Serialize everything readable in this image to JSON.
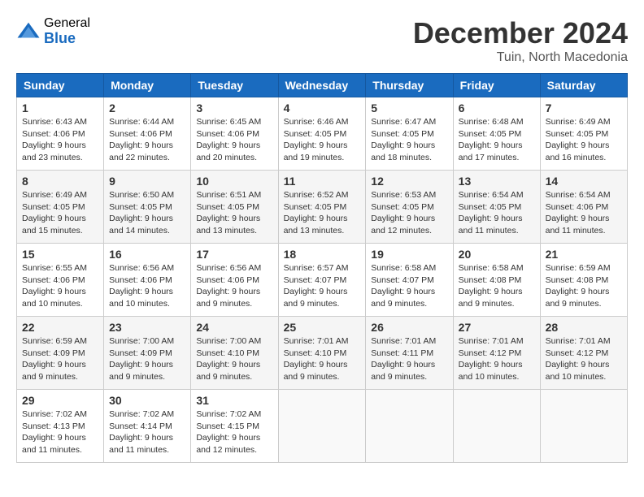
{
  "header": {
    "logo_general": "General",
    "logo_blue": "Blue",
    "month_title": "December 2024",
    "subtitle": "Tuin, North Macedonia"
  },
  "days_of_week": [
    "Sunday",
    "Monday",
    "Tuesday",
    "Wednesday",
    "Thursday",
    "Friday",
    "Saturday"
  ],
  "weeks": [
    [
      {
        "day": "1",
        "sunrise": "6:43 AM",
        "sunset": "4:06 PM",
        "daylight": "9 hours and 23 minutes."
      },
      {
        "day": "2",
        "sunrise": "6:44 AM",
        "sunset": "4:06 PM",
        "daylight": "9 hours and 22 minutes."
      },
      {
        "day": "3",
        "sunrise": "6:45 AM",
        "sunset": "4:06 PM",
        "daylight": "9 hours and 20 minutes."
      },
      {
        "day": "4",
        "sunrise": "6:46 AM",
        "sunset": "4:05 PM",
        "daylight": "9 hours and 19 minutes."
      },
      {
        "day": "5",
        "sunrise": "6:47 AM",
        "sunset": "4:05 PM",
        "daylight": "9 hours and 18 minutes."
      },
      {
        "day": "6",
        "sunrise": "6:48 AM",
        "sunset": "4:05 PM",
        "daylight": "9 hours and 17 minutes."
      },
      {
        "day": "7",
        "sunrise": "6:49 AM",
        "sunset": "4:05 PM",
        "daylight": "9 hours and 16 minutes."
      }
    ],
    [
      {
        "day": "8",
        "sunrise": "6:49 AM",
        "sunset": "4:05 PM",
        "daylight": "9 hours and 15 minutes."
      },
      {
        "day": "9",
        "sunrise": "6:50 AM",
        "sunset": "4:05 PM",
        "daylight": "9 hours and 14 minutes."
      },
      {
        "day": "10",
        "sunrise": "6:51 AM",
        "sunset": "4:05 PM",
        "daylight": "9 hours and 13 minutes."
      },
      {
        "day": "11",
        "sunrise": "6:52 AM",
        "sunset": "4:05 PM",
        "daylight": "9 hours and 13 minutes."
      },
      {
        "day": "12",
        "sunrise": "6:53 AM",
        "sunset": "4:05 PM",
        "daylight": "9 hours and 12 minutes."
      },
      {
        "day": "13",
        "sunrise": "6:54 AM",
        "sunset": "4:05 PM",
        "daylight": "9 hours and 11 minutes."
      },
      {
        "day": "14",
        "sunrise": "6:54 AM",
        "sunset": "4:06 PM",
        "daylight": "9 hours and 11 minutes."
      }
    ],
    [
      {
        "day": "15",
        "sunrise": "6:55 AM",
        "sunset": "4:06 PM",
        "daylight": "9 hours and 10 minutes."
      },
      {
        "day": "16",
        "sunrise": "6:56 AM",
        "sunset": "4:06 PM",
        "daylight": "9 hours and 10 minutes."
      },
      {
        "day": "17",
        "sunrise": "6:56 AM",
        "sunset": "4:06 PM",
        "daylight": "9 hours and 9 minutes."
      },
      {
        "day": "18",
        "sunrise": "6:57 AM",
        "sunset": "4:07 PM",
        "daylight": "9 hours and 9 minutes."
      },
      {
        "day": "19",
        "sunrise": "6:58 AM",
        "sunset": "4:07 PM",
        "daylight": "9 hours and 9 minutes."
      },
      {
        "day": "20",
        "sunrise": "6:58 AM",
        "sunset": "4:08 PM",
        "daylight": "9 hours and 9 minutes."
      },
      {
        "day": "21",
        "sunrise": "6:59 AM",
        "sunset": "4:08 PM",
        "daylight": "9 hours and 9 minutes."
      }
    ],
    [
      {
        "day": "22",
        "sunrise": "6:59 AM",
        "sunset": "4:09 PM",
        "daylight": "9 hours and 9 minutes."
      },
      {
        "day": "23",
        "sunrise": "7:00 AM",
        "sunset": "4:09 PM",
        "daylight": "9 hours and 9 minutes."
      },
      {
        "day": "24",
        "sunrise": "7:00 AM",
        "sunset": "4:10 PM",
        "daylight": "9 hours and 9 minutes."
      },
      {
        "day": "25",
        "sunrise": "7:01 AM",
        "sunset": "4:10 PM",
        "daylight": "9 hours and 9 minutes."
      },
      {
        "day": "26",
        "sunrise": "7:01 AM",
        "sunset": "4:11 PM",
        "daylight": "9 hours and 9 minutes."
      },
      {
        "day": "27",
        "sunrise": "7:01 AM",
        "sunset": "4:12 PM",
        "daylight": "9 hours and 10 minutes."
      },
      {
        "day": "28",
        "sunrise": "7:01 AM",
        "sunset": "4:12 PM",
        "daylight": "9 hours and 10 minutes."
      }
    ],
    [
      {
        "day": "29",
        "sunrise": "7:02 AM",
        "sunset": "4:13 PM",
        "daylight": "9 hours and 11 minutes."
      },
      {
        "day": "30",
        "sunrise": "7:02 AM",
        "sunset": "4:14 PM",
        "daylight": "9 hours and 11 minutes."
      },
      {
        "day": "31",
        "sunrise": "7:02 AM",
        "sunset": "4:15 PM",
        "daylight": "9 hours and 12 minutes."
      },
      null,
      null,
      null,
      null
    ]
  ],
  "daylight_label": "Daylight hours",
  "sunrise_label": "Sunrise:",
  "sunset_label": "Sunset:"
}
